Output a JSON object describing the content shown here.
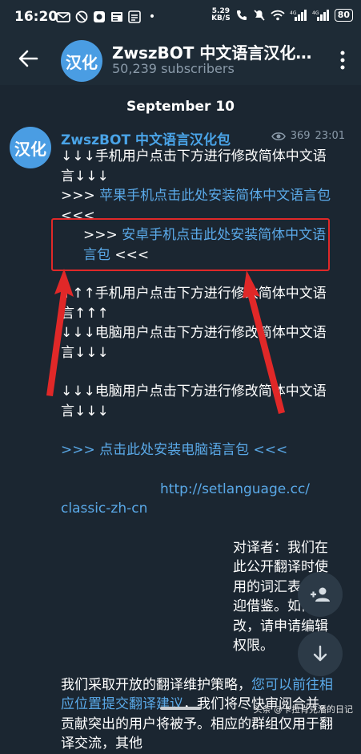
{
  "status_bar": {
    "time": "16:20",
    "speed_value": "5.29",
    "speed_unit": "KB/S",
    "battery": "80"
  },
  "header": {
    "avatar_text": "汉化",
    "title": "ZwszBOT 中文语言汉化…",
    "subscribers": "50,239 subscribers"
  },
  "date": "September 10",
  "post": {
    "avatar_text": "汉化",
    "author": "ZwszBOT 中文语言汉化包",
    "views": "369",
    "time": "23:01",
    "lines": {
      "l1": "↓↓↓手机用户点击下方进行修改简体中文语言↓↓↓",
      "l2_prefix": ">>> ",
      "l2_link": "苹果手机点击此处安装简体中文语言包",
      "l2_suffix": " <<<",
      "l3_prefix": ">>> ",
      "l3_link": "安卓手机点击此处安装简体中文语言包",
      "l3_suffix": " <<<",
      "l4": "↑↑↑手机用户点击下方进行修改简体中文语言↑↑↑",
      "l5": "↓↓↓电脑用户点击下方进行修改简体中文语言↓↓↓",
      "l6": "↓↓↓电脑用户点击下方进行修改简体中文语言↓↓↓",
      "l7_link": ">>> 点击此处安装电脑语言包 <<<",
      "l8_link": "http://setlanguage.cc/",
      "l8b_link": "classic-zh-cn",
      "l9": "对译者：我们在此公开翻译时使用的词汇表，欢迎借鉴。如需修改，请申请编辑权限。",
      "l10_a": "我们采取开放的翻译维护策略，",
      "l10_link": "您可以前往相应位置提交翻译建议",
      "l10_b": "，我们将尽快审阅合并。贡献突出的用户将被予。相应的群组仅用于翻译交流，其他"
    }
  },
  "watermark": "头条 @卡拉肖克潘的日记",
  "colors": {
    "background": "#1b2631",
    "header": "#1e2b36",
    "link": "#5aa9e8",
    "annotation_red": "#e02828"
  }
}
